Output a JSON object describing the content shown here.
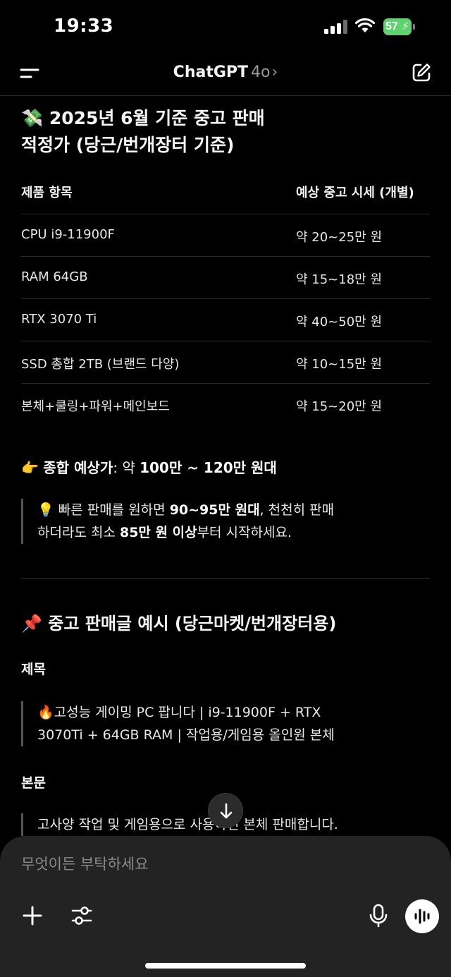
{
  "status_bar": {
    "time": "19:33",
    "battery_percent": "57"
  },
  "header": {
    "title": "ChatGPT",
    "model": "4o",
    "chevron": "›"
  },
  "content": {
    "heading_emoji": "💸",
    "heading_line1": "2025년 6월 기준 중고 판매",
    "heading_line2": "적정가 (당근/번개장터 기준)",
    "table": {
      "headers": [
        "제품 항목",
        "예상 중고 시세 (개별)"
      ],
      "rows": [
        [
          "CPU i9-11900F",
          "약 20~25만 원"
        ],
        [
          "RAM 64GB",
          "약 15~18만 원"
        ],
        [
          "RTX 3070 Ti",
          "약 40~50만 원"
        ],
        [
          "SSD 총합 2TB (브랜드 다양)",
          "약 10~15만 원"
        ],
        [
          "본체+쿨링+파워+메인보드",
          "약 15~20만 원"
        ]
      ]
    },
    "summary": {
      "emoji": "👉",
      "label": "종합 예상가",
      "colon": ": 약 ",
      "value": "100만 ~ 120만 원대"
    },
    "tip": {
      "emoji": "💡",
      "part1": "빠른 판매를 원하면 ",
      "bold1": "90~95만 원대",
      "part2": ", 천천히 판매",
      "part3": "하더라도 최소 ",
      "bold2": "85만 원 이상",
      "part4": "부터 시작하세요."
    },
    "section_emoji": "📌",
    "section_title": "중고 판매글 예시 (당근마켓/번개장터용)",
    "title_label": "제목",
    "post_title_emoji": "🔥",
    "post_title_line1": "고성능 게이밍 PC 팝니다 | i9-11900F + RTX",
    "post_title_line2": "3070Ti + 64GB RAM | 작업용/게임용 올인원 본체",
    "body_label": "본문",
    "body_line1": "고사양 작업 및 게임용으로 사용하던 본체 판매합니다."
  },
  "composer": {
    "placeholder": "무엇이든 부탁하세요"
  },
  "icons": {
    "menu": "menu-icon",
    "new_chat": "edit-icon",
    "scroll_down": "arrow-down-icon",
    "plus": "plus-icon",
    "tools": "sliders-icon",
    "mic": "mic-icon",
    "voice": "voice-waveform-icon"
  },
  "colors": {
    "background": "#000000",
    "battery": "#5ed26e",
    "composer": "#232323"
  }
}
